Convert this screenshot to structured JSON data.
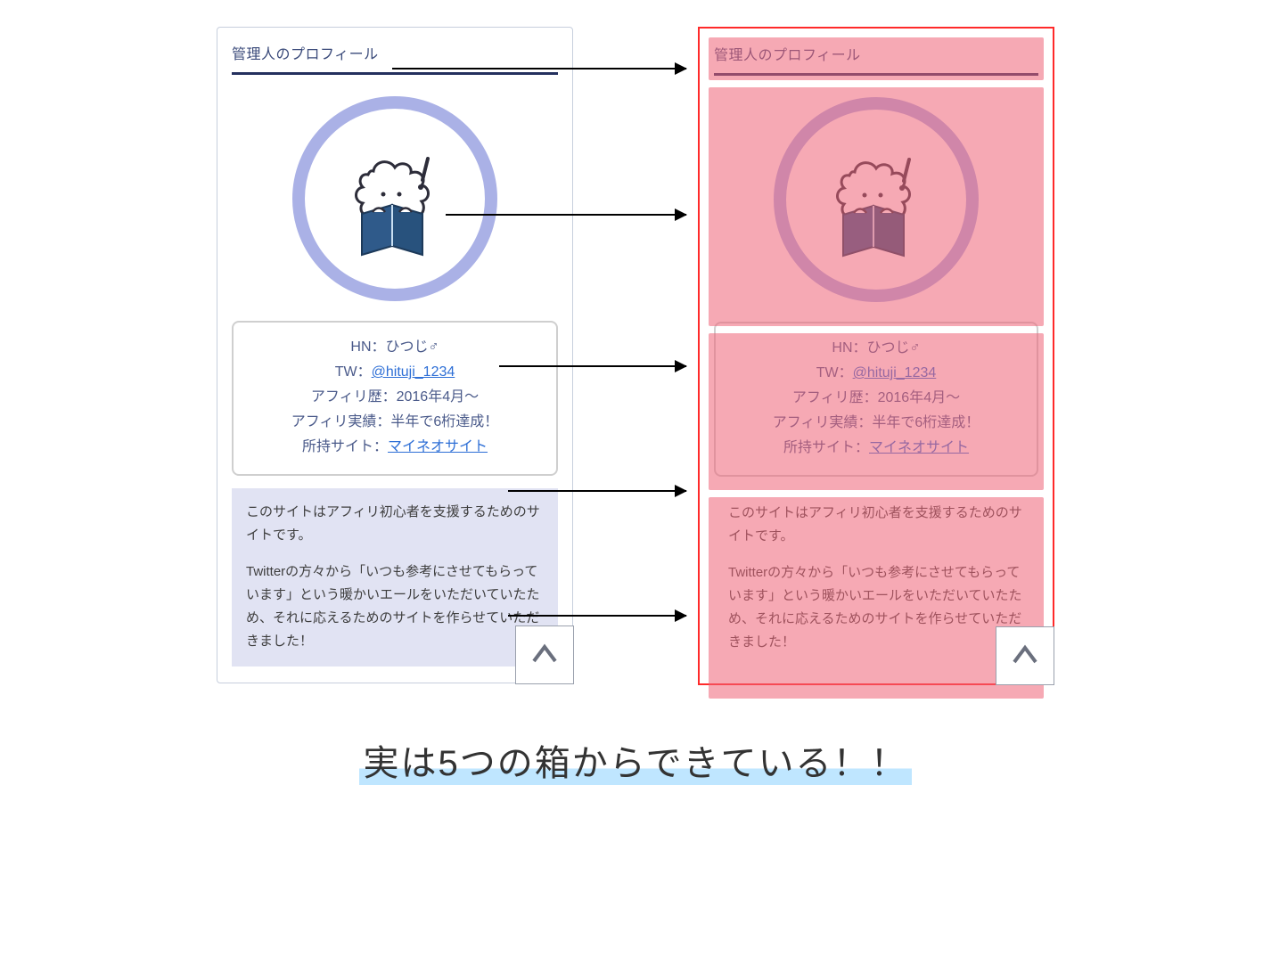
{
  "heading": "管理人のプロフィール",
  "info": {
    "hn_label": "HN：",
    "hn_value": "ひつじ♂",
    "tw_label": "TW：",
    "tw_value": "@hituji_1234",
    "since_label": "アフィリ歴：",
    "since_value": "2016年4月〜",
    "record_label": "アフィリ実績：",
    "record_value": "半年で6桁達成！",
    "site_label": "所持サイト：",
    "site_value": "マイネオサイト"
  },
  "desc": {
    "p1": "このサイトはアフィリ初心者を支援するためのサイトです。",
    "p2": "Twitterの方々から「いつも参考にさせてもらっています」という暖かいエールをいただいていたため、それに応えるためのサイトを作らせていただきました！"
  },
  "caption": "実は5つの箱からできている！！",
  "icons": {
    "avatar": "sheep-reading-icon",
    "scroll": "chevron-up-icon"
  }
}
